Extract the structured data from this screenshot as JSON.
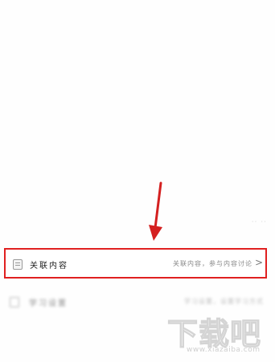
{
  "faint_top_text": "·· ··",
  "related_row": {
    "icon": "document-icon",
    "title": "关联内容",
    "description": "关联内容，参与内容讨论",
    "chevron": "chevron-right-icon"
  },
  "blurred_row": {
    "icon": "document-icon",
    "title": "学习设置",
    "description": "学习设置，设置学习方式"
  },
  "annotation": {
    "arrow_color": "#d42020",
    "highlight_color": "#e02020"
  },
  "watermark": {
    "main": "下载吧",
    "sub": "www.xiazaiba.com"
  }
}
